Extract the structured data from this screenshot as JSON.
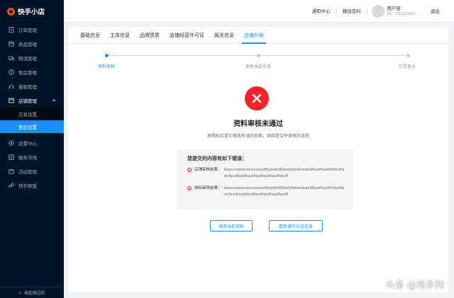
{
  "app": {
    "logo_text": "快手小店"
  },
  "sidebar": {
    "items": [
      {
        "label": "订单管理",
        "icon": "document-icon"
      },
      {
        "label": "商品管理",
        "icon": "box-icon"
      },
      {
        "label": "物流管理",
        "icon": "truck-icon"
      },
      {
        "label": "售后管理",
        "icon": "refund-icon"
      },
      {
        "label": "客服管理",
        "icon": "headset-icon"
      },
      {
        "label": "店铺管理",
        "icon": "store-icon",
        "open": true
      },
      {
        "label": "设置中心",
        "icon": "gear-icon"
      },
      {
        "label": "服务市场",
        "icon": "grid-icon"
      },
      {
        "label": "活动管理",
        "icon": "calendar-icon"
      },
      {
        "label": "快手联盟",
        "icon": "link-icon"
      }
    ],
    "submenu": [
      {
        "label": "交易设置"
      },
      {
        "label": "售后设置",
        "active": true
      }
    ],
    "collapse_label": "收起侧边栏"
  },
  "header": {
    "links": [
      "通知中心",
      "赚钱百科"
    ],
    "user_name": "用户名",
    "user_id": "ID：23321233",
    "logout": "退出"
  },
  "tabs": [
    "基础信息",
    "主体信息",
    "品牌资质",
    "店铺经营许可证",
    "报关信息",
    "店铺升级"
  ],
  "active_tab": 5,
  "steps": [
    {
      "label": "资料审核",
      "active": true
    },
    {
      "label": "更新收款信息",
      "active": false
    },
    {
      "label": "正常营业",
      "active": false
    }
  ],
  "result": {
    "title": "资料审核未通过",
    "subtitle": "按照标红提示修改有误的页面，继续提交并审核的流程",
    "status_color": "#f5222d"
  },
  "errors": {
    "title": "您提交的内容有如下错误：",
    "rows": [
      {
        "label": "店铺审核结果：",
        "value": "baocuowenanxxxxsdfkjaslkdfjlaskjfwieoieasdfasdfasdfsfdsdfadsfasdfasdfasdfasdfasdfasdfasdf"
      },
      {
        "label": "商标审核结果：",
        "value": "baocuowenanxxxxsdfkjaslkdfjlaskjfwieoieasdfasdfasdfsfdsdfadsfasdfasdfasdfasdfasdfasdfasdf"
      }
    ]
  },
  "buttons": {
    "modify": "修改当前资料",
    "refill": "重新填写认证信息"
  },
  "watermark": {
    "text": "头条 @甩手网"
  },
  "colors": {
    "accent": "#1890ff",
    "sidebar_bg": "#001529",
    "error": "#f5222d"
  }
}
